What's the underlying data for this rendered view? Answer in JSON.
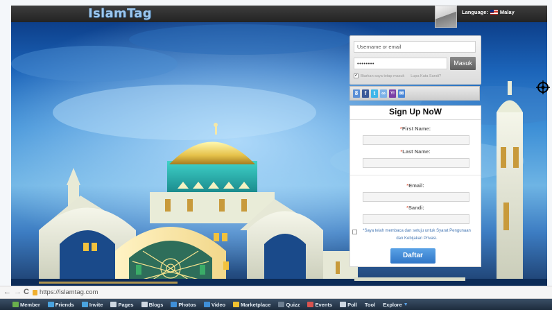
{
  "header": {
    "logo": "IslamTag",
    "language_label": "Language:",
    "language_value": "Malay"
  },
  "login": {
    "username_placeholder": "Username or email",
    "password_value": "••••••••",
    "submit_label": "Masuk",
    "remember_label": "Biarkan saya tetap masuk",
    "forgot_label": "Lupa Kata Sandi?"
  },
  "social": [
    {
      "icon": "google-icon",
      "glyph": "8",
      "color": "#5b8fd6"
    },
    {
      "icon": "facebook-icon",
      "glyph": "f",
      "color": "#3b5998"
    },
    {
      "icon": "twitter-icon",
      "glyph": "t",
      "color": "#3fb6e9"
    },
    {
      "icon": "windows-live-icon",
      "glyph": "∞",
      "color": "#7db2e8"
    },
    {
      "icon": "yahoo-icon",
      "glyph": "Y!",
      "color": "#7b3fa6"
    },
    {
      "icon": "mail-icon",
      "glyph": "✉",
      "color": "#4a86d6"
    }
  ],
  "signup": {
    "title": "Sign Up NoW",
    "required_mark": "*",
    "first_name_label": "First Name:",
    "last_name_label": "Last Name:",
    "email_label": "Email:",
    "password_label": "Sandi:",
    "agree_line1": "*Saya telah membaca dan setuju untuk Syarat Pengunaan",
    "agree_line2": "dan Kebijakan Privasi.",
    "submit_label": "Daftar"
  },
  "browser": {
    "back": "←",
    "forward": "→",
    "reload": "C",
    "url": "https://islamtag.com"
  },
  "appbar": {
    "items": [
      {
        "label": "Member",
        "icon": "member-icon",
        "color": "#6ab04c"
      },
      {
        "label": "Friends",
        "icon": "friends-icon",
        "color": "#4aa3df"
      },
      {
        "label": "Invite",
        "icon": "invite-icon",
        "color": "#4aa3df"
      },
      {
        "label": "Pages",
        "icon": "pages-icon",
        "color": "#cfd8e2"
      },
      {
        "label": "Blogs",
        "icon": "blogs-icon",
        "color": "#cfd8e2"
      },
      {
        "label": "Photos",
        "icon": "photos-icon",
        "color": "#3f8fd8"
      },
      {
        "label": "Video",
        "icon": "video-icon",
        "color": "#3f8fd8"
      },
      {
        "label": "Marketplace",
        "icon": "marketplace-icon",
        "color": "#f2c230"
      },
      {
        "label": "Quizz",
        "icon": "quizz-icon",
        "color": "#6e7f91"
      },
      {
        "label": "Events",
        "icon": "events-icon",
        "color": "#d9534f"
      },
      {
        "label": "Poll",
        "icon": "poll-icon",
        "color": "#cfd8e2"
      },
      {
        "label": "Tool",
        "icon": "",
        "color": ""
      },
      {
        "label": "Explore",
        "icon": "",
        "color": ""
      }
    ]
  },
  "colors": {
    "accent_blue": "#2f76c7",
    "required_red": "#e5735c",
    "header_dark": "#232323"
  }
}
